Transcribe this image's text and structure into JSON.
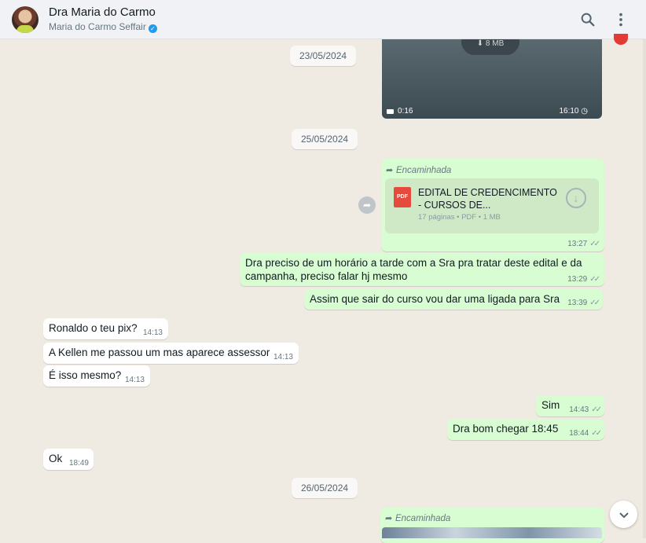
{
  "header": {
    "title": "Dra Maria do Carmo",
    "subtitle": "Maria do Carmo Seffair",
    "verified_glyph": "✓",
    "icons": {
      "search": "search-icon",
      "menu": "more-vertical-icon"
    }
  },
  "video_msg": {
    "size": "8 MB",
    "duration": "0:16",
    "time": "16:10"
  },
  "dates": {
    "d1": "23/05/2024",
    "d2": "25/05/2024",
    "d3": "26/05/2024"
  },
  "forward_label": "Encaminhada",
  "doc_msg": {
    "name": "EDITAL DE CREDENCIMENTO - CURSOS DE...",
    "meta": "17 páginas • PDF • 1 MB",
    "badge": "PDF",
    "time": "13:27"
  },
  "messages": {
    "m1": {
      "text": "Dra preciso de um horário a tarde com a Sra pra tratar deste edital e da campanha, preciso falar hj mesmo",
      "time": "13:29"
    },
    "m2": {
      "text": "Assim que sair do curso vou dar uma ligada para Sra",
      "time": "13:39"
    },
    "m3": {
      "text": "Ronaldo o teu pix?",
      "time": "14:13"
    },
    "m4": {
      "text": "A Kellen me passou um mas aparece assessor",
      "time": "14:13"
    },
    "m5": {
      "text": "É isso mesmo?",
      "time": "14:13"
    },
    "m6": {
      "text": "Sim",
      "time": "14:43"
    },
    "m7": {
      "text": "Dra bom chegar 18:45",
      "time": "18:44"
    },
    "m8": {
      "text": "Ok",
      "time": "18:49"
    }
  },
  "colors": {
    "outgoing": "#d9fdd3",
    "incoming": "#ffffff",
    "background": "#efeae2"
  }
}
